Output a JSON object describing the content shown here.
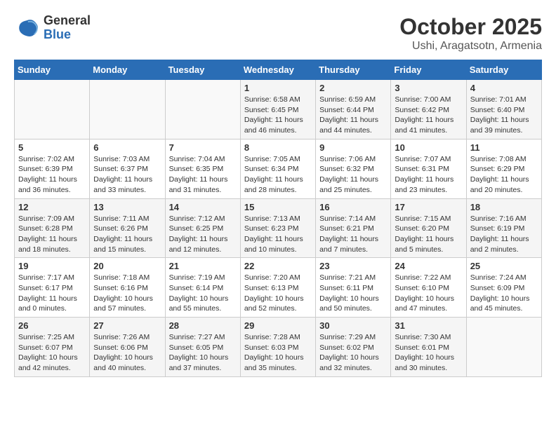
{
  "header": {
    "logo_general": "General",
    "logo_blue": "Blue",
    "month_title": "October 2025",
    "location": "Ushi, Aragatsotn, Armenia"
  },
  "weekdays": [
    "Sunday",
    "Monday",
    "Tuesday",
    "Wednesday",
    "Thursday",
    "Friday",
    "Saturday"
  ],
  "weeks": [
    [
      {
        "day": "",
        "info": ""
      },
      {
        "day": "",
        "info": ""
      },
      {
        "day": "",
        "info": ""
      },
      {
        "day": "1",
        "info": "Sunrise: 6:58 AM\nSunset: 6:45 PM\nDaylight: 11 hours and 46 minutes."
      },
      {
        "day": "2",
        "info": "Sunrise: 6:59 AM\nSunset: 6:44 PM\nDaylight: 11 hours and 44 minutes."
      },
      {
        "day": "3",
        "info": "Sunrise: 7:00 AM\nSunset: 6:42 PM\nDaylight: 11 hours and 41 minutes."
      },
      {
        "day": "4",
        "info": "Sunrise: 7:01 AM\nSunset: 6:40 PM\nDaylight: 11 hours and 39 minutes."
      }
    ],
    [
      {
        "day": "5",
        "info": "Sunrise: 7:02 AM\nSunset: 6:39 PM\nDaylight: 11 hours and 36 minutes."
      },
      {
        "day": "6",
        "info": "Sunrise: 7:03 AM\nSunset: 6:37 PM\nDaylight: 11 hours and 33 minutes."
      },
      {
        "day": "7",
        "info": "Sunrise: 7:04 AM\nSunset: 6:35 PM\nDaylight: 11 hours and 31 minutes."
      },
      {
        "day": "8",
        "info": "Sunrise: 7:05 AM\nSunset: 6:34 PM\nDaylight: 11 hours and 28 minutes."
      },
      {
        "day": "9",
        "info": "Sunrise: 7:06 AM\nSunset: 6:32 PM\nDaylight: 11 hours and 25 minutes."
      },
      {
        "day": "10",
        "info": "Sunrise: 7:07 AM\nSunset: 6:31 PM\nDaylight: 11 hours and 23 minutes."
      },
      {
        "day": "11",
        "info": "Sunrise: 7:08 AM\nSunset: 6:29 PM\nDaylight: 11 hours and 20 minutes."
      }
    ],
    [
      {
        "day": "12",
        "info": "Sunrise: 7:09 AM\nSunset: 6:28 PM\nDaylight: 11 hours and 18 minutes."
      },
      {
        "day": "13",
        "info": "Sunrise: 7:11 AM\nSunset: 6:26 PM\nDaylight: 11 hours and 15 minutes."
      },
      {
        "day": "14",
        "info": "Sunrise: 7:12 AM\nSunset: 6:25 PM\nDaylight: 11 hours and 12 minutes."
      },
      {
        "day": "15",
        "info": "Sunrise: 7:13 AM\nSunset: 6:23 PM\nDaylight: 11 hours and 10 minutes."
      },
      {
        "day": "16",
        "info": "Sunrise: 7:14 AM\nSunset: 6:21 PM\nDaylight: 11 hours and 7 minutes."
      },
      {
        "day": "17",
        "info": "Sunrise: 7:15 AM\nSunset: 6:20 PM\nDaylight: 11 hours and 5 minutes."
      },
      {
        "day": "18",
        "info": "Sunrise: 7:16 AM\nSunset: 6:19 PM\nDaylight: 11 hours and 2 minutes."
      }
    ],
    [
      {
        "day": "19",
        "info": "Sunrise: 7:17 AM\nSunset: 6:17 PM\nDaylight: 11 hours and 0 minutes."
      },
      {
        "day": "20",
        "info": "Sunrise: 7:18 AM\nSunset: 6:16 PM\nDaylight: 10 hours and 57 minutes."
      },
      {
        "day": "21",
        "info": "Sunrise: 7:19 AM\nSunset: 6:14 PM\nDaylight: 10 hours and 55 minutes."
      },
      {
        "day": "22",
        "info": "Sunrise: 7:20 AM\nSunset: 6:13 PM\nDaylight: 10 hours and 52 minutes."
      },
      {
        "day": "23",
        "info": "Sunrise: 7:21 AM\nSunset: 6:11 PM\nDaylight: 10 hours and 50 minutes."
      },
      {
        "day": "24",
        "info": "Sunrise: 7:22 AM\nSunset: 6:10 PM\nDaylight: 10 hours and 47 minutes."
      },
      {
        "day": "25",
        "info": "Sunrise: 7:24 AM\nSunset: 6:09 PM\nDaylight: 10 hours and 45 minutes."
      }
    ],
    [
      {
        "day": "26",
        "info": "Sunrise: 7:25 AM\nSunset: 6:07 PM\nDaylight: 10 hours and 42 minutes."
      },
      {
        "day": "27",
        "info": "Sunrise: 7:26 AM\nSunset: 6:06 PM\nDaylight: 10 hours and 40 minutes."
      },
      {
        "day": "28",
        "info": "Sunrise: 7:27 AM\nSunset: 6:05 PM\nDaylight: 10 hours and 37 minutes."
      },
      {
        "day": "29",
        "info": "Sunrise: 7:28 AM\nSunset: 6:03 PM\nDaylight: 10 hours and 35 minutes."
      },
      {
        "day": "30",
        "info": "Sunrise: 7:29 AM\nSunset: 6:02 PM\nDaylight: 10 hours and 32 minutes."
      },
      {
        "day": "31",
        "info": "Sunrise: 7:30 AM\nSunset: 6:01 PM\nDaylight: 10 hours and 30 minutes."
      },
      {
        "day": "",
        "info": ""
      }
    ]
  ]
}
